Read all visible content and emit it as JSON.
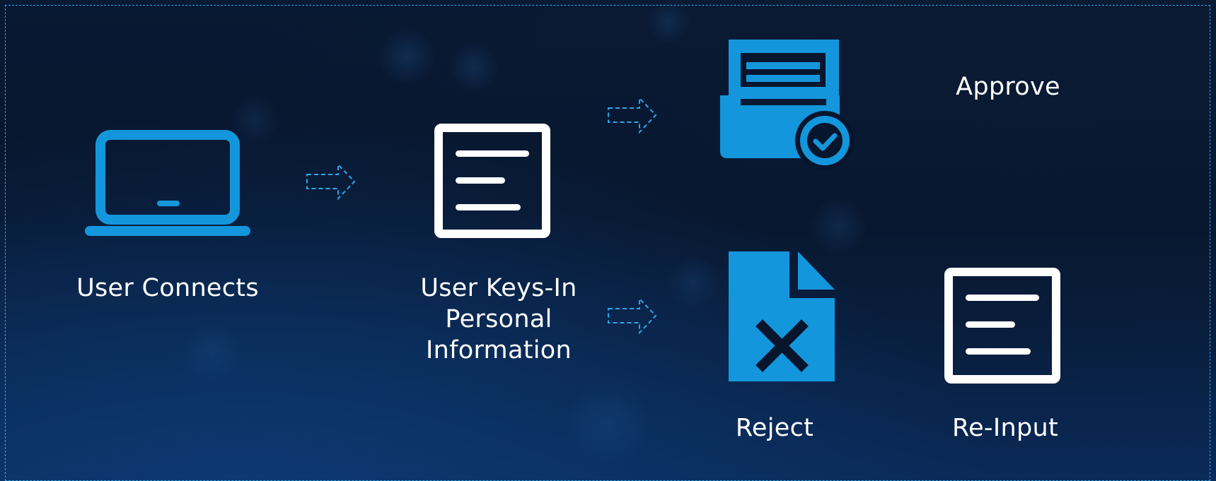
{
  "colors": {
    "icon_blue": "#1496dc",
    "icon_white": "#ffffff",
    "arrow_blue": "#2aa7e8",
    "background": "#07162d"
  },
  "diagram": {
    "steps": {
      "user_connects": {
        "label": "User Connects",
        "icon": "laptop-icon"
      },
      "user_keys_in": {
        "label": "User Keys-In\nPersonal\nInformation",
        "icon": "form-document-icon"
      },
      "approve": {
        "label": "Approve",
        "icon": "approved-document-icon"
      },
      "reject": {
        "label": "Reject",
        "icon": "rejected-file-icon"
      },
      "re_input": {
        "label": "Re-Input",
        "icon": "form-document-icon"
      }
    },
    "arrows": [
      {
        "from": "user_connects",
        "to": "user_keys_in"
      },
      {
        "from": "user_keys_in",
        "to": "approve"
      },
      {
        "from": "user_keys_in",
        "to": "reject"
      }
    ]
  }
}
